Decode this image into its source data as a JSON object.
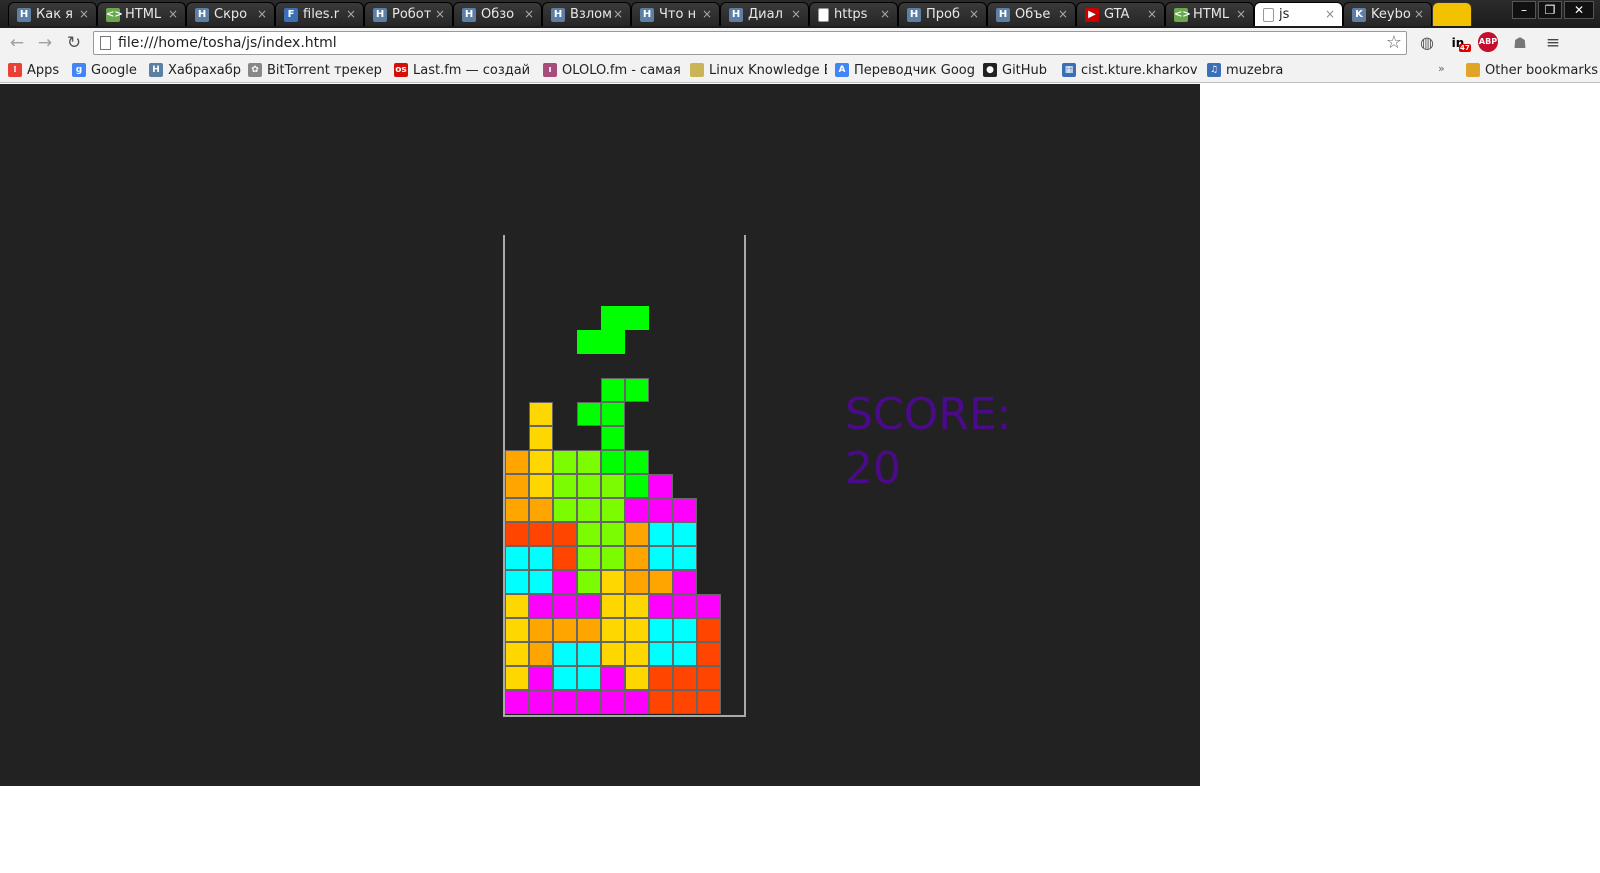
{
  "browser": {
    "tabs": [
      {
        "label": "Как я",
        "icon": "habr-icon",
        "color": "#5c7fa3",
        "glyph": "H"
      },
      {
        "label": "HTML",
        "icon": "html-icon",
        "color": "#6aa84f",
        "glyph": "<>"
      },
      {
        "label": "Скро",
        "icon": "habr-icon",
        "color": "#5c7fa3",
        "glyph": "H"
      },
      {
        "label": "files.r",
        "icon": "files-icon",
        "color": "#3b6fb6",
        "glyph": "F"
      },
      {
        "label": "Робот",
        "icon": "habr-icon",
        "color": "#5c7fa3",
        "glyph": "H"
      },
      {
        "label": "Обзо",
        "icon": "habr-icon",
        "color": "#5c7fa3",
        "glyph": "H"
      },
      {
        "label": "Взлом",
        "icon": "habr-icon",
        "color": "#5c7fa3",
        "glyph": "H"
      },
      {
        "label": "Что н",
        "icon": "habr-icon",
        "color": "#5c7fa3",
        "glyph": "H"
      },
      {
        "label": "Диал",
        "icon": "habr-icon",
        "color": "#5c7fa3",
        "glyph": "H"
      },
      {
        "label": "https",
        "icon": "page-icon",
        "color": "#dddddd",
        "glyph": ""
      },
      {
        "label": "Проб",
        "icon": "habr-icon",
        "color": "#5c7fa3",
        "glyph": "H"
      },
      {
        "label": "Объе",
        "icon": "habr-icon",
        "color": "#5c7fa3",
        "glyph": "H"
      },
      {
        "label": "GTA",
        "icon": "youtube-icon",
        "color": "#cc0000",
        "glyph": "▶"
      },
      {
        "label": "HTML",
        "icon": "html-icon",
        "color": "#6aa84f",
        "glyph": "<>"
      },
      {
        "label": "js",
        "icon": "page-icon",
        "color": "#dddddd",
        "glyph": "",
        "active": true
      },
      {
        "label": "Keybo",
        "icon": "keyboard-icon",
        "color": "#5c7fa3",
        "glyph": "K"
      }
    ],
    "window_controls": {
      "minimize": "–",
      "restore": "❐",
      "close": "✕"
    },
    "toolbar": {
      "back": "←",
      "forward": "→",
      "reload": "↻",
      "url": "file:///home/tosha/js/index.html",
      "star": "☆",
      "linkedin_label": "in",
      "linkedin_badge": "47",
      "abp_label": "ABP",
      "ghostery": "◍",
      "ghost": "☗",
      "menu": "≡"
    },
    "bookmarks": [
      {
        "label": "Apps",
        "icon": "apps-icon",
        "color": "#e94235",
        "glyph": "⁞"
      },
      {
        "label": "Google",
        "icon": "google-icon",
        "color": "#4285f4",
        "glyph": "g"
      },
      {
        "label": "Хабрахабр",
        "icon": "habr-icon",
        "color": "#5c7fa3",
        "glyph": "H"
      },
      {
        "label": "BitTorrent трекер",
        "icon": "bittorrent-icon",
        "color": "#888888",
        "glyph": "✿"
      },
      {
        "label": "Last.fm — создай с",
        "icon": "lastfm-icon",
        "color": "#d51007",
        "glyph": "os"
      },
      {
        "label": "OLOLO.fm - самая",
        "icon": "ololo-icon",
        "color": "#a64d79",
        "glyph": "ı"
      },
      {
        "label": "Linux Knowledge B",
        "icon": "linux-icon",
        "color": "#c9b458",
        "glyph": ""
      },
      {
        "label": "Переводчик Googl",
        "icon": "translate-icon",
        "color": "#4285f4",
        "glyph": "A"
      },
      {
        "label": "GitHub",
        "icon": "github-icon",
        "color": "#222222",
        "glyph": "●"
      },
      {
        "label": "cist.kture.kharkov.u",
        "icon": "cist-icon",
        "color": "#3b6fb6",
        "glyph": "▦"
      },
      {
        "label": "muzebra",
        "icon": "muzebra-icon",
        "color": "#3b6fb6",
        "glyph": "♫"
      }
    ],
    "bookmarks_overflow": "»",
    "other_bookmarks": {
      "label": "Other bookmarks",
      "icon": "folder-icon",
      "color": "#e0a526"
    }
  },
  "game": {
    "score_label": "SCORE:",
    "score_value": "20",
    "cols": 10,
    "rows": 20,
    "colors": {
      "Y": "#ffd700",
      "O": "#ffa500",
      "R": "#ff4500",
      "C": "#00ffff",
      "M": "#ff00ff",
      "G": "#00ff00",
      "L": "#7cfc00"
    },
    "falling_piece": {
      "color": "G",
      "cells": [
        [
          4,
          3
        ],
        [
          5,
          3
        ],
        [
          3,
          4
        ],
        [
          4,
          4
        ]
      ]
    },
    "grid": [
      "..........",
      "..........",
      "..........",
      "..........",
      "..........",
      "..........",
      "....GG....",
      ".Y.GG.....",
      ".Y..G.....",
      "OYLLGG....",
      "OYLLLGM...",
      "OOLLLMMM..",
      "RRRLLOCC..",
      "CCRLLOCC..",
      "CCMLYOOM..",
      "YMMMYYMMM.",
      "YOOOYYCCR.",
      "YOCCYYCCR.",
      "YMCCMYRRR.",
      "MMMMMMRRR."
    ]
  }
}
